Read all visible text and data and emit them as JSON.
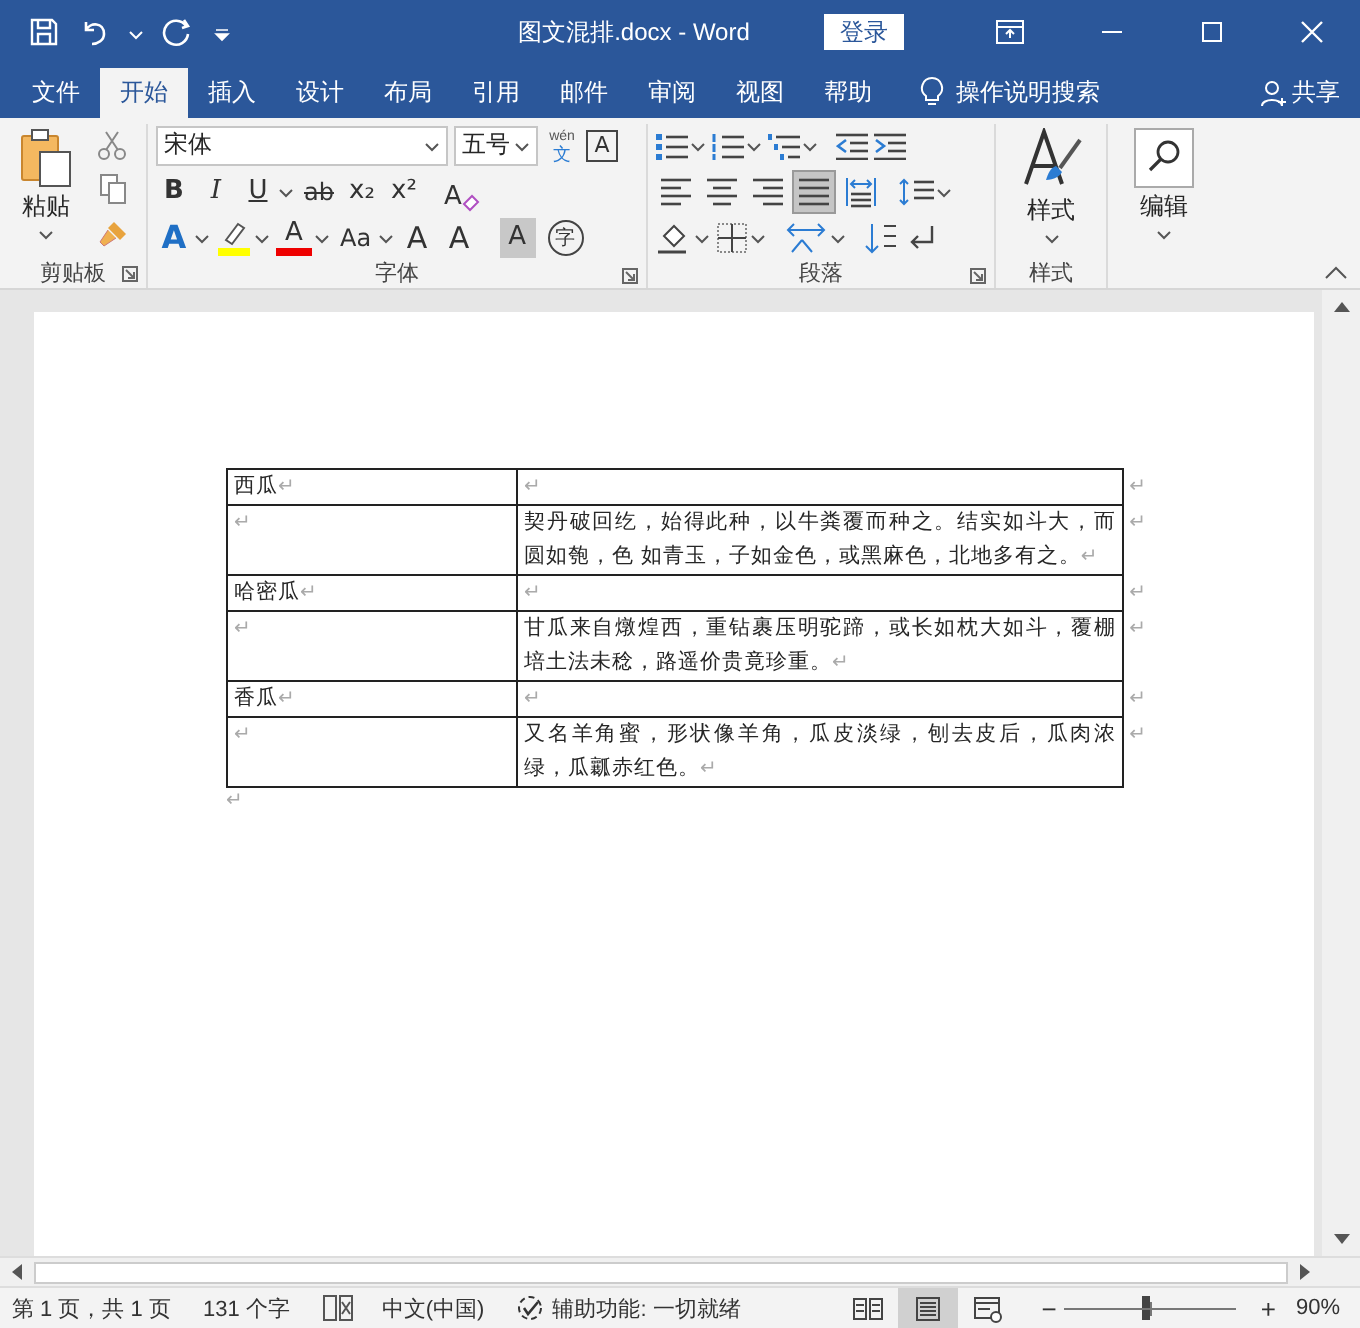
{
  "window": {
    "title": "图文混排.docx  -  Word",
    "sign_in": "登录"
  },
  "tabs": [
    {
      "label": "文件",
      "selected": false
    },
    {
      "label": "开始",
      "selected": true
    },
    {
      "label": "插入",
      "selected": false
    },
    {
      "label": "设计",
      "selected": false
    },
    {
      "label": "布局",
      "selected": false
    },
    {
      "label": "引用",
      "selected": false
    },
    {
      "label": "邮件",
      "selected": false
    },
    {
      "label": "审阅",
      "selected": false
    },
    {
      "label": "视图",
      "selected": false
    },
    {
      "label": "帮助",
      "selected": false
    }
  ],
  "tell_me": "操作说明搜索",
  "share": "共享",
  "ribbon": {
    "clipboard": {
      "label": "剪贴板",
      "paste": "粘贴"
    },
    "font": {
      "label": "字体",
      "font_name": "宋体",
      "font_size": "五号",
      "wen": "wén",
      "wen_char": "文",
      "border_char": "A",
      "row2": [
        "B",
        "I",
        "U",
        "ab",
        "x₂",
        "x²"
      ],
      "clear_char": "A",
      "row3": [
        "A",
        "A",
        "Aa",
        "A",
        "A",
        "A",
        "字"
      ]
    },
    "paragraph": {
      "label": "段落",
      "alignments": [
        {
          "selected": false
        },
        {
          "selected": false
        },
        {
          "selected": false
        },
        {
          "selected": true
        },
        {
          "selected": false
        }
      ]
    },
    "styles": {
      "label": "样式",
      "button": "样式"
    },
    "editing": {
      "button": "编辑"
    }
  },
  "document": {
    "rows": [
      {
        "cells": [
          {
            "text": "西瓜",
            "mark": "↵"
          },
          {
            "text": "",
            "mark": "↵"
          }
        ],
        "row_mark": "↵"
      },
      {
        "cells": [
          {
            "text": "",
            "mark": "↵"
          },
          {
            "text": "契丹破回纥，始得此种，以牛粪覆而种之。结实如斗大，而圆如匏，色 如青玉，子如金色，或黑麻色，北地多有之。",
            "mark": "↵"
          }
        ],
        "row_mark": "↵"
      },
      {
        "cells": [
          {
            "text": "哈密瓜",
            "mark": "↵"
          },
          {
            "text": "",
            "mark": "↵"
          }
        ],
        "row_mark": "↵"
      },
      {
        "cells": [
          {
            "text": "",
            "mark": "↵"
          },
          {
            "text": "甘瓜来自燉煌西，重钻裹压明驼蹄，或长如枕大如斗，覆棚培土法未稔，路遥价贵竟珍重。",
            "mark": "↵"
          }
        ],
        "row_mark": "↵"
      },
      {
        "cells": [
          {
            "text": "香瓜",
            "mark": "↵"
          },
          {
            "text": "",
            "mark": "↵"
          }
        ],
        "row_mark": "↵"
      },
      {
        "cells": [
          {
            "text": "",
            "mark": "↵"
          },
          {
            "text": "又名羊角蜜，形状像羊角，瓜皮淡绿，刨去皮后，瓜肉浓绿，瓜瓤赤红色。",
            "mark": "↵"
          }
        ],
        "row_mark": "↵"
      }
    ],
    "end_mark": "↵"
  },
  "status_bar": {
    "page": "第 1 页，共 1 页",
    "words": "131 个字",
    "language": "中文(中国)",
    "accessibility": "辅助功能: 一切就绪",
    "views": [
      {
        "selected": false
      },
      {
        "selected": true
      },
      {
        "selected": false
      }
    ],
    "zoom_out": "−",
    "zoom_in": "+",
    "zoom": {
      "level": 0.47
    },
    "zoom_text": "90%"
  }
}
